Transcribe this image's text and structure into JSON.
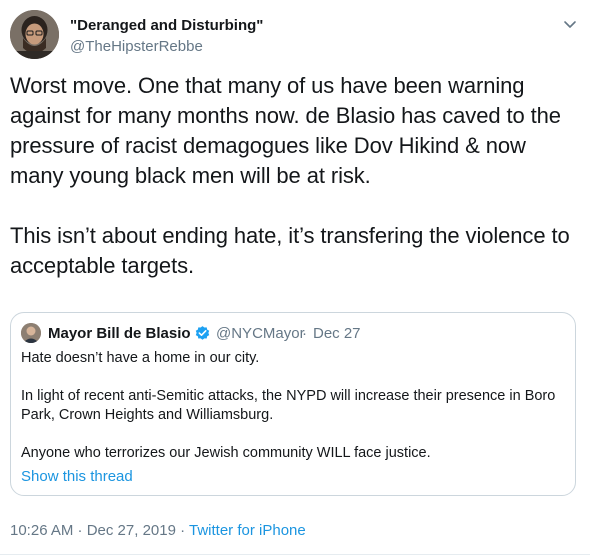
{
  "author": {
    "display_name": "\"Deranged and Disturbing\"",
    "handle": "@TheHipsterRebbe"
  },
  "menu_icon": "chevron-down-icon",
  "tweet": {
    "text": "Worst move. One that many of us have been warning against for many months now. de Blasio has caved to the pressure of racist demagogues like Dov Hikind & now many young black men will be at risk.\n\nThis isn’t about ending hate, it’s transfering the violence to acceptable targets."
  },
  "quoted_tweet": {
    "name": "Mayor Bill de Blasio",
    "verified_icon": "verified-badge-icon",
    "handle": "@NYCMayor",
    "separator": "·",
    "date": "Dec 27",
    "text": "Hate doesn’t have a home in our city.\n\nIn light of recent anti-Semitic attacks, the NYPD will increase their presence in Boro Park, Crown Heights and Williamsburg.\n\nAnyone who terrorizes our Jewish community WILL face justice.",
    "show_thread": "Show this thread"
  },
  "meta": {
    "timestamp": "10:26 AM · Dec 27, 2019 · ",
    "source": "Twitter for iPhone"
  },
  "colors": {
    "link": "#1b95e0",
    "secondary_text": "#657786",
    "border": "#ccd6dd",
    "verified": "#1da1f2"
  }
}
